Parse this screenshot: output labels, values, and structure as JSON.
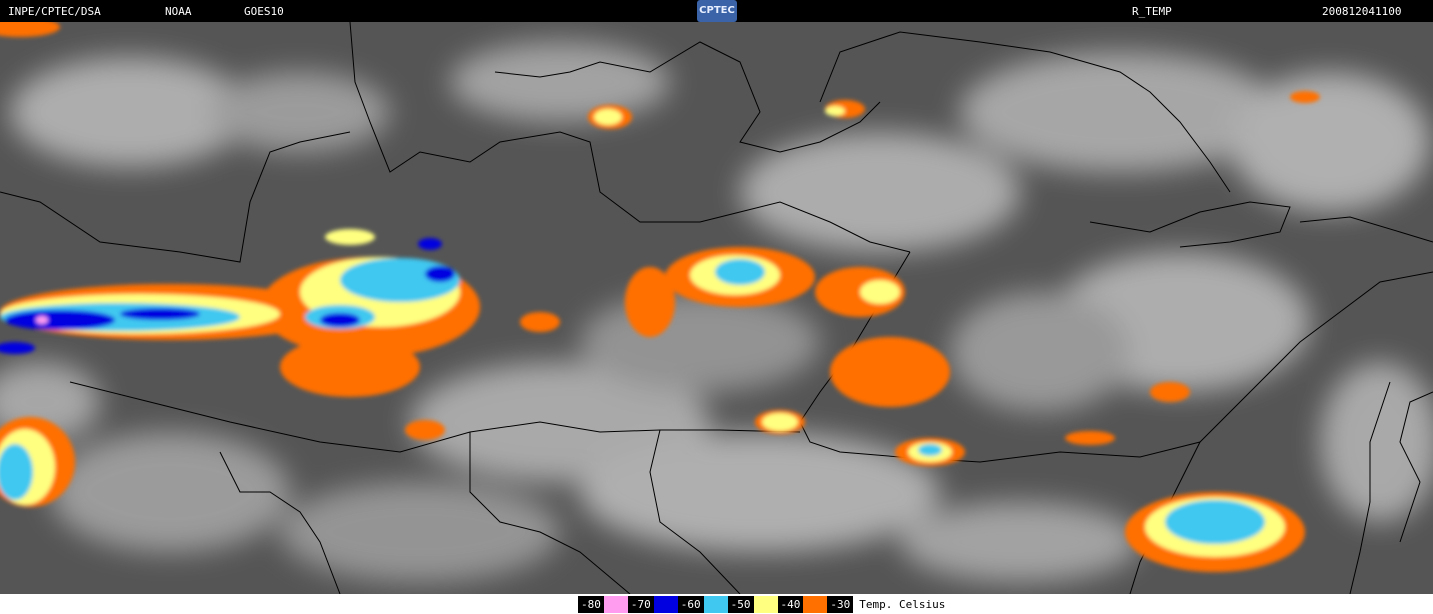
{
  "header": {
    "source": "INPE/CPTEC/DSA",
    "agency": "NOAA",
    "satellite": "GOES10",
    "logo": "CPTEC",
    "product": "R_TEMP",
    "datetime": "200812041100"
  },
  "legend": {
    "unit": "Temp. Celsius",
    "entries": [
      {
        "label": "-80",
        "color": "#ff9cf0"
      },
      {
        "label": "-70",
        "color": "#0000e0"
      },
      {
        "label": "-60",
        "color": "#40c8f0"
      },
      {
        "label": "-50",
        "color": "#ffff80"
      },
      {
        "label": "-40",
        "color": "#ff7000"
      },
      {
        "label": "-30",
        "color": null
      }
    ]
  },
  "colors": {
    "background": "#5a5a5a",
    "cloud": "#b8b8b8",
    "border_line": "#000000"
  }
}
